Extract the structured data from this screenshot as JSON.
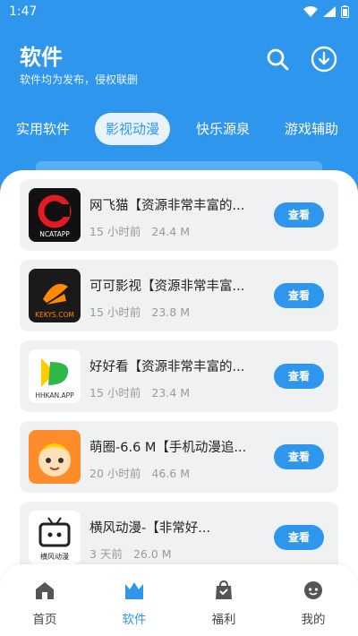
{
  "status": {
    "time": "1:47"
  },
  "header": {
    "title": "软件",
    "subtitle": "软件均为发布，侵权联删"
  },
  "tabs": [
    {
      "label": "实用软件",
      "active": false
    },
    {
      "label": "影视动漫",
      "active": true
    },
    {
      "label": "快乐源泉",
      "active": false
    },
    {
      "label": "游戏辅助",
      "active": false
    }
  ],
  "apps": [
    {
      "title": "网飞猫【资源非常丰富的...",
      "time": "15 小时前",
      "size": "24.4 M",
      "button": "查看",
      "icon_text": "NCATAPP",
      "accent": "#e31b23"
    },
    {
      "title": "可可影视【资源非常丰富...",
      "time": "15 小时前",
      "size": "23.8 M",
      "button": "查看",
      "icon_text": "KEKYS.COM",
      "accent": "#ff8a00"
    },
    {
      "title": "好好看【资源非常丰富的...",
      "time": "15 小时前",
      "size": "23.4 M",
      "button": "查看",
      "icon_text": "HHKAN.APP",
      "accent": "#ffb400"
    },
    {
      "title": "萌圈-6.6 M【手机动漫追...",
      "time": "20 小时前",
      "size": "46.6 M",
      "button": "查看",
      "icon_text": "",
      "accent": "#ff8c2a"
    },
    {
      "title": "横风动漫-【非常好...",
      "time": "3 天前",
      "size": "26.0 M",
      "button": "查看",
      "icon_text": "横风动漫",
      "accent": "#222222"
    }
  ],
  "nav": [
    {
      "label": "首页",
      "icon": "home-icon",
      "active": false
    },
    {
      "label": "软件",
      "icon": "software-icon",
      "active": true
    },
    {
      "label": "福利",
      "icon": "gift-icon",
      "active": false
    },
    {
      "label": "我的",
      "icon": "profile-icon",
      "active": false
    }
  ],
  "colors": {
    "accent": "#2f96ee",
    "background": "#f1f3f6"
  }
}
